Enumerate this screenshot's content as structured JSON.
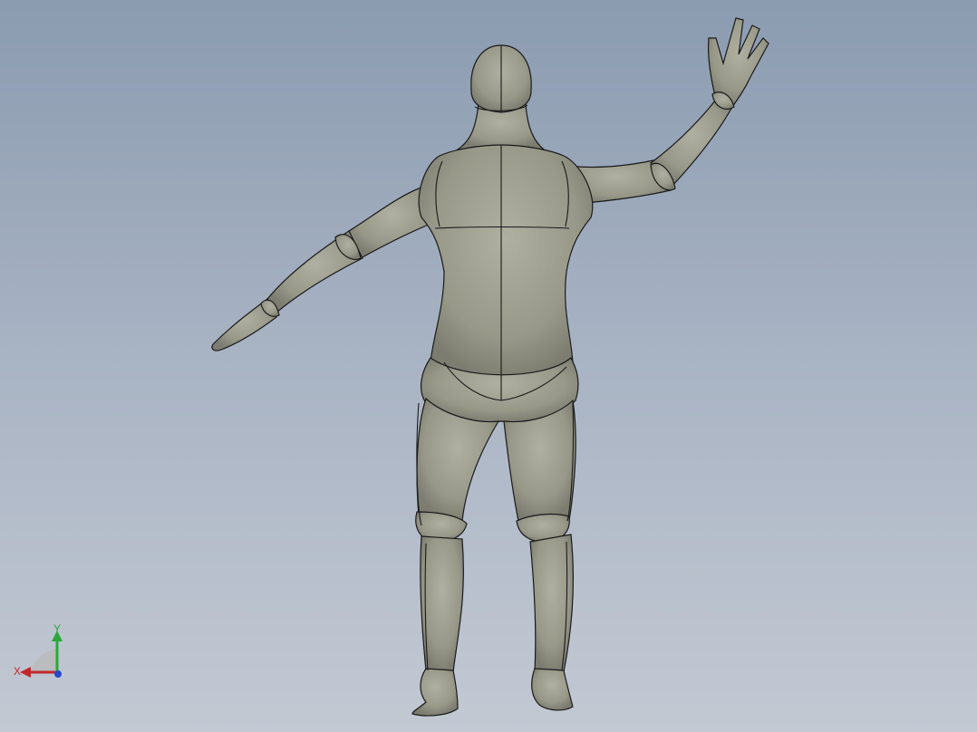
{
  "viewport": {
    "model_name": "",
    "background_top": "#8b9bb0",
    "background_bottom": "#c3c9d3",
    "model_color": "#9a9a8c",
    "edge_color": "#1a1a1a"
  },
  "triad": {
    "x_label": "X",
    "y_label": "Y",
    "x_color": "#c0282a",
    "y_color": "#2aa83a",
    "z_color": "#2a46c8"
  }
}
